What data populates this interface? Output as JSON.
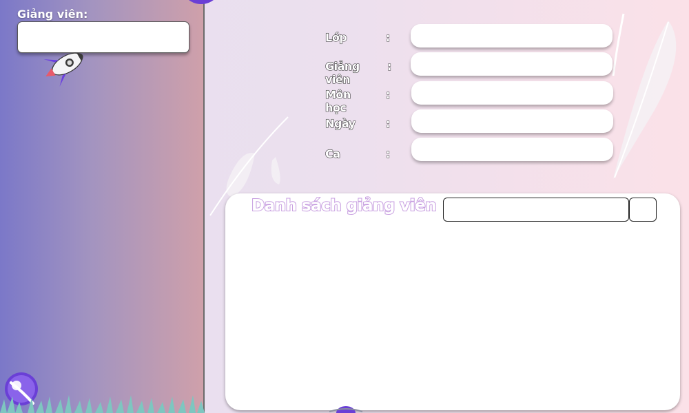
{
  "sidebar": {
    "lecturer_label": "Giảng viên:",
    "lecturer_value": ""
  },
  "form": {
    "class_label": "Lớp",
    "lecturer_label": "Giảng viên",
    "subject_label": "Môn học",
    "date_label": "Ngày",
    "shift_label": "Ca",
    "colon": ":",
    "class_value": "",
    "lecturer_value": "",
    "subject_value": "",
    "date_value": "",
    "shift_value": ""
  },
  "list": {
    "title": "Danh sách giảng viên",
    "search_value": "",
    "search_button_label": ""
  },
  "colors": {
    "sidebar_start": "#7b78c8",
    "sidebar_end": "#cfa0aa",
    "title_outline": "#c79ee0",
    "planet": "#6a3fd6"
  }
}
